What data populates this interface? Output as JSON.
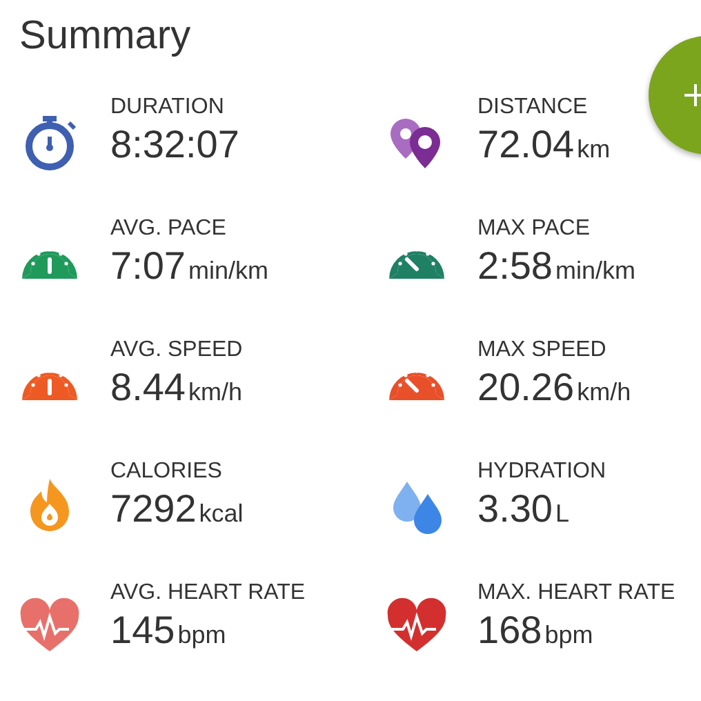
{
  "title": "Summary",
  "stats": [
    {
      "kind": "stopwatch",
      "color": "#3f5fb0",
      "label": "DURATION",
      "value": "8:32:07"
    },
    {
      "kind": "pins",
      "color": "#7b2d93",
      "label": "DISTANCE",
      "value": "72.04",
      "unit": "km"
    },
    {
      "kind": "gauge",
      "color": "#1f9a5a",
      "label": "AVG. PACE",
      "value": "7:07",
      "unit": "min/km"
    },
    {
      "kind": "peakgauge",
      "color": "#1f8064",
      "label": "MAX PACE",
      "value": "2:58",
      "unit": "min/km"
    },
    {
      "kind": "gauge",
      "color": "#ee5a24",
      "label": "AVG. SPEED",
      "value": "8.44",
      "unit": "km/h"
    },
    {
      "kind": "peakgauge",
      "color": "#e8502a",
      "label": "MAX SPEED",
      "value": "20.26",
      "unit": "km/h"
    },
    {
      "kind": "flame",
      "color": "#f5961f",
      "label": "CALORIES",
      "value": "7292",
      "unit": "kcal"
    },
    {
      "kind": "drops",
      "color": "#3d86e6",
      "label": "HYDRATION",
      "value": "3.30",
      "unit": "L"
    },
    {
      "kind": "heart",
      "color": "#e8706a",
      "label": "AVG. HEART RATE",
      "value": "145",
      "unit": "bpm"
    },
    {
      "kind": "heart",
      "color": "#d32f2f",
      "label": "MAX. HEART RATE",
      "value": "168",
      "unit": "bpm"
    }
  ]
}
